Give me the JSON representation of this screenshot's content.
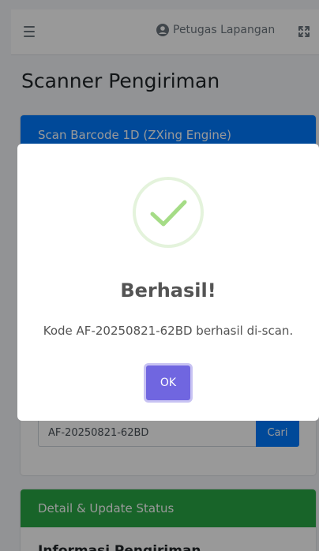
{
  "navbar": {
    "user_name": "Petugas Lapangan",
    "icons": {
      "menu": "hamburger-icon",
      "user": "user-circle-icon",
      "fullscreen": "expand-icon"
    }
  },
  "page": {
    "title": "Scanner Pengiriman"
  },
  "scanner_card": {
    "header": "Scan Barcode 1D (ZXing Engine)",
    "search_value": "AF-20250821-62BD",
    "search_button": "Cari"
  },
  "detail_card": {
    "header": "Detail & Update Status",
    "subheading": "Informasi Pengiriman"
  },
  "modal": {
    "title": "Berhasil!",
    "message": "Kode AF-20250821-62BD berhasil di-scan.",
    "ok_label": "OK",
    "icon": "success-check-icon"
  },
  "colors": {
    "primary": "#007bff",
    "success": "#28a745",
    "modal_button": "#7066e0",
    "check": "#a5dc86"
  }
}
